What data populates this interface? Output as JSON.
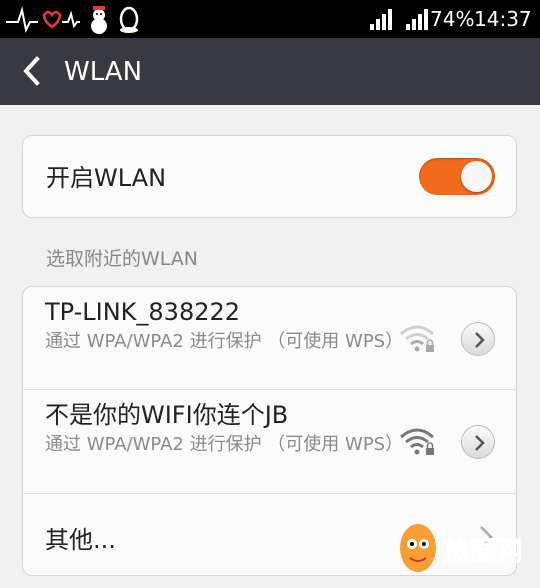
{
  "status_bar": {
    "battery": "74%",
    "time": "14:37",
    "icons": [
      "heartbeat-icon",
      "snowman-icon",
      "qq-penguin-icon",
      "signal-icon",
      "signal-icon"
    ]
  },
  "header": {
    "title": "WLAN",
    "back_icon": "chevron-left-icon"
  },
  "wlan_toggle": {
    "label": "开启WLAN",
    "on": true,
    "accent": "#f26a1b"
  },
  "section": {
    "header": "选取附近的WLAN"
  },
  "networks": [
    {
      "name": "TP-LINK_838222",
      "security": "通过 WPA/WPA2 进行保护 （可使用 WPS）",
      "signal_level": 0.5,
      "locked": true
    },
    {
      "name": "不是你的WIFI你连个JB",
      "security": "通过 WPA/WPA2 进行保护 （可使用 WPS）",
      "signal_level": 1.0,
      "locked": true
    }
  ],
  "other": {
    "label": "其他..."
  },
  "watermark": {
    "text": "热图网"
  }
}
